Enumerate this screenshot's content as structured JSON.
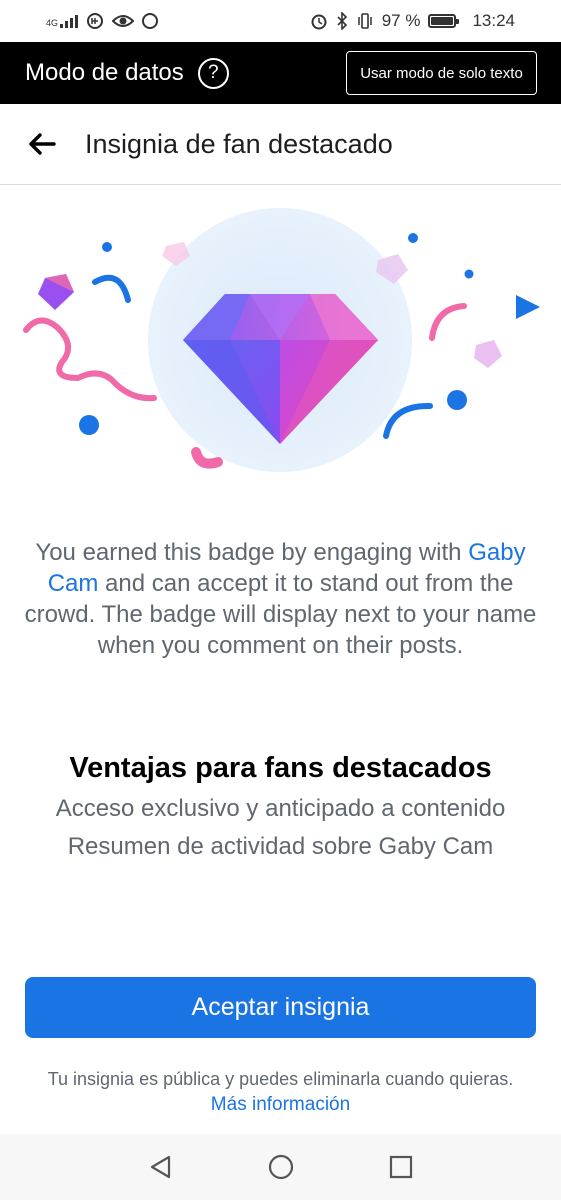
{
  "status_bar": {
    "network": "4G",
    "battery_percent": "97 %",
    "time": "13:24",
    "battery_level": 0.97
  },
  "data_mode": {
    "title": "Modo de datos",
    "help_symbol": "?",
    "text_only_button": "Usar modo de solo texto"
  },
  "header": {
    "title": "Insignia de fan destacado"
  },
  "illustration": {
    "icon": "diamond-badge-icon",
    "colors": {
      "pink": "#f06aa9",
      "blue": "#1b74e4",
      "circle_bg": "#e3f0fc"
    }
  },
  "description": {
    "before": "You earned this badge by engaging with ",
    "creator": "Gaby Cam",
    "after": " and can accept it to stand out from the crowd. The badge will display next to your name when you comment on their posts."
  },
  "benefits": {
    "title": "Ventajas para fans destacados",
    "items": [
      "Acceso exclusivo y anticipado a contenido",
      "Resumen de actividad sobre Gaby Cam"
    ]
  },
  "accept_button": "Aceptar insignia",
  "footer": {
    "note": "Tu insignia es pública y puedes eliminarla cuando quieras.",
    "link": "Más información"
  },
  "nav": {
    "icons": [
      "back-triangle-icon",
      "home-circle-icon",
      "recents-square-icon"
    ]
  }
}
